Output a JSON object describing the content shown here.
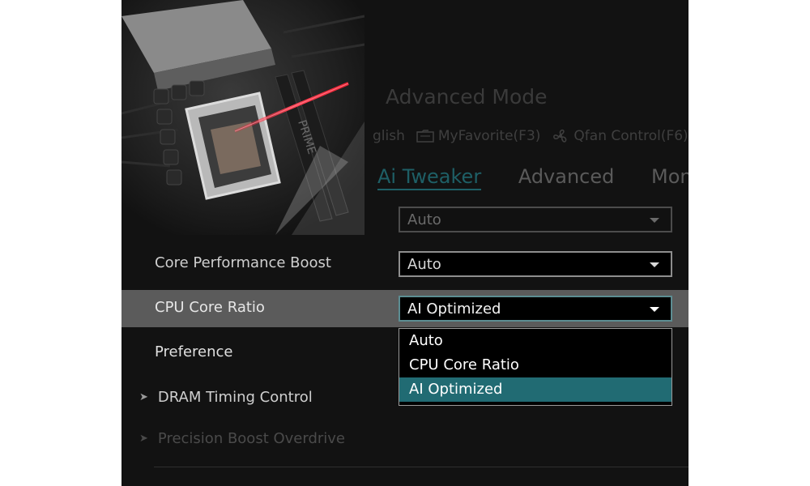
{
  "header": {
    "mode_title": "Advanced Mode",
    "toolbar": {
      "language": "glish",
      "my_favorite": "MyFavorite(F3)",
      "qfan_control": "Qfan Control(F6)"
    }
  },
  "tabs": [
    {
      "label": "Ai Tweaker",
      "active": true
    },
    {
      "label": "Advanced",
      "active": false
    },
    {
      "label": "Monit",
      "active": false
    }
  ],
  "settings": {
    "top_select_value": "Auto",
    "core_performance_boost": {
      "label": "Core Performance Boost",
      "value": "Auto"
    },
    "cpu_core_ratio": {
      "label": "CPU Core Ratio",
      "value": "AI Optimized"
    },
    "preference": {
      "label": "Preference"
    },
    "dram_timing_control": {
      "label": "DRAM Timing Control"
    },
    "precision_boost_overdrive": {
      "label": "Precision Boost Overdrive"
    }
  },
  "dropdown": {
    "options": [
      "Auto",
      "CPU Core Ratio",
      "AI Optimized"
    ],
    "selected": "AI Optimized"
  },
  "colors": {
    "accent": "#216b73",
    "active_tab": "#1e5f66",
    "row_highlight": "#5b5b5b",
    "laser": "#ff3344"
  }
}
